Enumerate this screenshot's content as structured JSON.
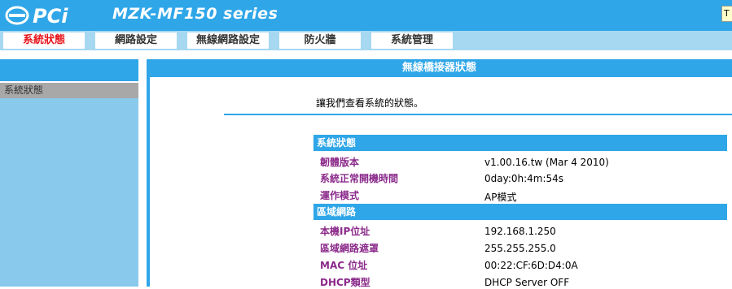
{
  "header": {
    "brand": "PCi",
    "model": "MZK-MF150 series",
    "corner_text": "T"
  },
  "nav": {
    "tabs": [
      {
        "label": "系統狀態",
        "active": true
      },
      {
        "label": "網路設定",
        "active": false
      },
      {
        "label": "無線網路設定",
        "active": false
      },
      {
        "label": "防火牆",
        "active": false
      },
      {
        "label": "系統管理",
        "active": false
      }
    ]
  },
  "sidebar": {
    "items": [
      {
        "label": "系統狀態"
      }
    ]
  },
  "main": {
    "title": "無線橋接器狀態",
    "intro": "讓我們查看系統的狀態。",
    "sections": [
      {
        "title": "系統狀態",
        "rows": [
          {
            "label": "韌體版本",
            "value": "v1.00.16.tw (Mar 4 2010)"
          },
          {
            "label": "系統正常開機時間",
            "value": "0day:0h:4m:54s"
          },
          {
            "label": "運作模式",
            "value": "AP模式"
          }
        ]
      },
      {
        "title": "區域網路",
        "rows": [
          {
            "label": "本機IP位址",
            "value": "192.168.1.250"
          },
          {
            "label": "區域網路遮罩",
            "value": "255.255.255.0"
          },
          {
            "label": "MAC 位址",
            "value": "00:22:CF:6D:D4:0A"
          },
          {
            "label": "DHCP類型",
            "value": "DHCP Server OFF"
          }
        ]
      }
    ]
  },
  "colors": {
    "header_blue": "#2fa6e8",
    "nav_light_blue": "#a6d8f2",
    "sidebar_blue": "#88c9ec",
    "active_tab_red": "#e8141c",
    "label_purple": "#8b2a8b"
  }
}
